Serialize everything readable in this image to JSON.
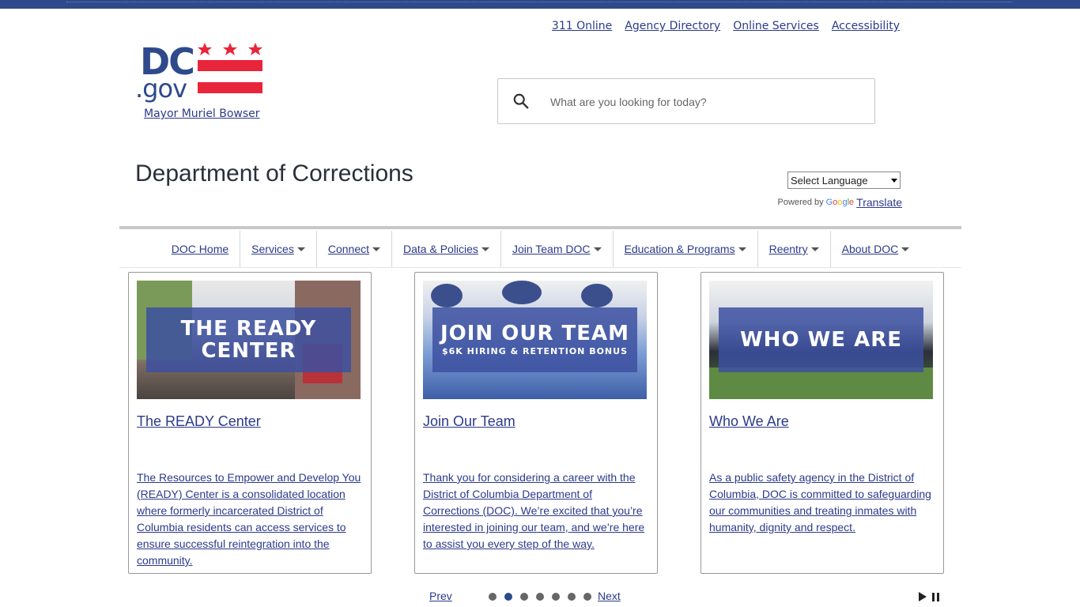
{
  "utility_links": [
    "311 Online",
    "Agency Directory",
    "Online Services",
    "Accessibility"
  ],
  "logo": {
    "dc": "DC",
    "gov": ".gov"
  },
  "mayor_link": "Mayor Muriel Bowser",
  "search": {
    "placeholder": "What are you looking for today?"
  },
  "page_title": "Department of Corrections",
  "language": {
    "select_label": "Select Language",
    "powered_by": "Powered by",
    "google": "Google",
    "translate": "Translate"
  },
  "nav": [
    {
      "label": "DOC Home",
      "dropdown": false
    },
    {
      "label": "Services",
      "dropdown": true
    },
    {
      "label": "Connect",
      "dropdown": true
    },
    {
      "label": "Data & Policies",
      "dropdown": true
    },
    {
      "label": "Join Team DOC",
      "dropdown": true
    },
    {
      "label": "Education & Programs",
      "dropdown": true
    },
    {
      "label": "Reentry",
      "dropdown": true
    },
    {
      "label": "About DOC",
      "dropdown": true
    }
  ],
  "cards": [
    {
      "banner_line1": "THE READY",
      "banner_line2": "CENTER",
      "heading": "The READY Center",
      "description": "The Resources to Empower and Develop You (READY) Center is a consolidated location where formerly incarcerated District of Columbia residents can access services to ensure successful reintegration into the community."
    },
    {
      "banner_line1": "JOIN OUR TEAM",
      "banner_line2": "$6K HIRING & RETENTION BONUS",
      "heading": "Join Our Team",
      "description": "Thank you for considering a career with the District of Columbia Department of Corrections (DOC). We’re excited that you’re interested in joining our team, and we’re here to assist you every step of the way."
    },
    {
      "banner_line1": "WHO WE ARE",
      "banner_line2": "",
      "heading": "Who We Are",
      "description": "As a public safety agency in the District of Columbia, DOC is committed to safeguarding our communities and treating inmates with humanity, dignity and respect."
    }
  ],
  "pager": {
    "prev": "Prev",
    "next": "Next",
    "dot_count": 7,
    "active_index": 1
  },
  "colors": {
    "brand_blue": "#2e4a8c",
    "link": "#2c3a8a",
    "dc_red": "#e8253a"
  }
}
